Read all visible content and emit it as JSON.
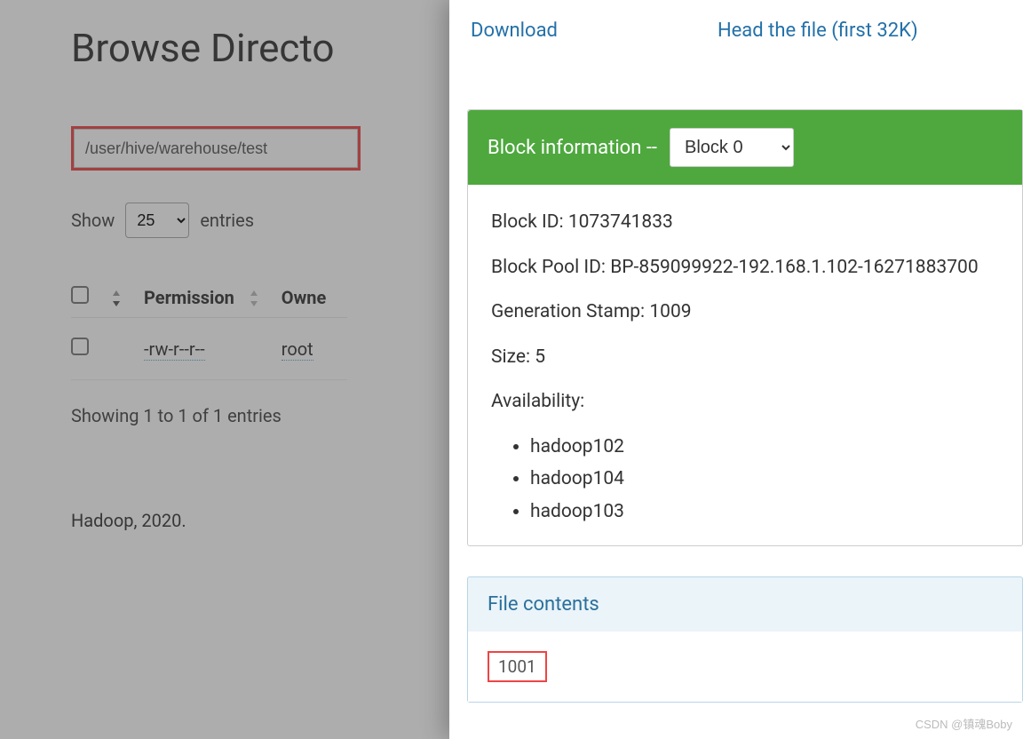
{
  "left": {
    "title": "Browse Directo",
    "path": "/user/hive/warehouse/test",
    "show_label": "Show",
    "entries_label": "entries",
    "entries_value": "25",
    "columns": {
      "permission": "Permission",
      "owner": "Owne"
    },
    "rows": [
      {
        "permission": "-rw-r--r--",
        "owner": "root"
      }
    ],
    "showing": "Showing 1 to 1 of 1 entries",
    "footer": "Hadoop, 2020."
  },
  "right": {
    "download_label": "Download",
    "head_label": "Head the file (first 32K)",
    "block_info_label": "Block information --",
    "block_selected": "Block 0",
    "block_id_label": "Block ID:",
    "block_id": "1073741833",
    "block_pool_label": "Block Pool ID:",
    "block_pool": "BP-859099922-192.168.1.102-16271883700",
    "gen_stamp_label": "Generation Stamp:",
    "gen_stamp": "1009",
    "size_label": "Size:",
    "size": "5",
    "availability_label": "Availability:",
    "availability": [
      "hadoop102",
      "hadoop104",
      "hadoop103"
    ],
    "file_contents_label": "File contents",
    "file_contents": "1001"
  },
  "watermark": "CSDN @镇魂Boby"
}
